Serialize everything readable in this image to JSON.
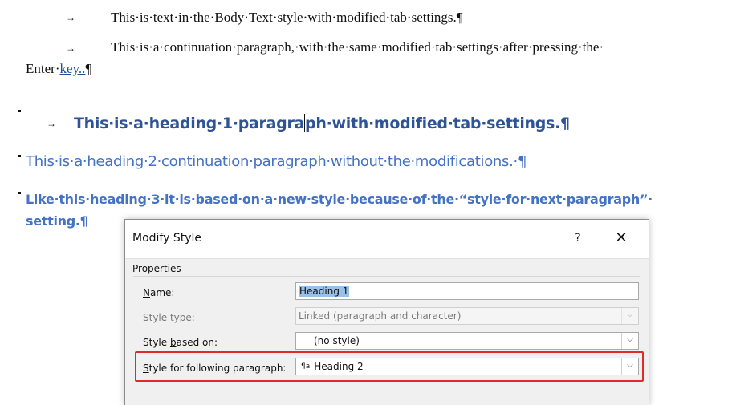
{
  "document": {
    "body1": "This·is·text·in·the·Body·Text·style·with·modified·tab·settings.¶",
    "body2a": "This·is·a·continuation·paragraph,·with·the·same·modified·tab·settings·after·pressing·the·",
    "body2b_prefix": "Enter·",
    "body2b_link": "key..",
    "body2b_suffix": "¶",
    "heading1_before": "This·is·a·heading·1·paragra",
    "heading1_after": "ph·with·modified·tab·settings.¶",
    "heading2": "This·is·a·heading·2·continuation·paragraph·without·the·modifications.·¶",
    "heading3a": "Like·this·heading·3·it·is·based·on·a·new·style·because·of·the·“style·for·next·paragraph”·",
    "heading3b": "setting.¶",
    "tab_glyph": "→"
  },
  "dialog": {
    "title": "Modify Style",
    "help": "?",
    "close": "✕",
    "group": "Properties",
    "name_label_u": "N",
    "name_label_rest": "ame:",
    "name_value": "Heading 1",
    "style_type_label": "Style type:",
    "style_type_value": "Linked (paragraph and character)",
    "based_on_label_pre": "Style ",
    "based_on_label_u": "b",
    "based_on_label_rest": "ased on:",
    "based_on_value": "(no style)",
    "following_label_u": "S",
    "following_label_rest": "tyle for following paragraph:",
    "following_icon": "¶a",
    "following_value": "Heading 2",
    "dropdown_glyph": "⌵"
  },
  "colors": {
    "heading1": "#2f5496",
    "heading2": "#4472c4",
    "highlight": "#e02b2b"
  }
}
